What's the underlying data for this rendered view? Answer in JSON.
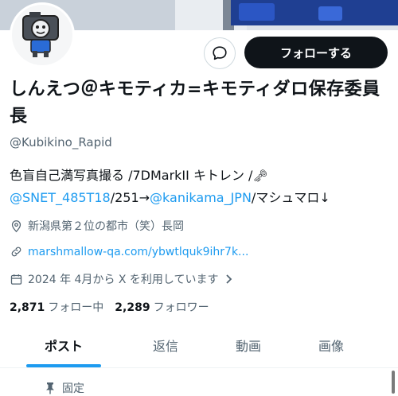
{
  "profile": {
    "display_name": "しんえつ＠キモティカ=キモティダロ保存委員長",
    "handle": "@Kubikino_Rapid"
  },
  "actions": {
    "message_icon": "chat-bubble-icon",
    "follow_label": "フォローする"
  },
  "bio": {
    "line1_text": "色盲自己満写真撮る /7DMarkII キトレン /",
    "key_icon": "key-emoji-icon",
    "mention1": "@SNET_485T18",
    "mid_text": "/251→",
    "mention2": "@kanikama_JPN",
    "end_text": "/マシュマロ↓"
  },
  "meta": {
    "location": "新潟県第２位の都市（笑）長岡",
    "website": "marshmallow-qa.com/ybwtlquk9ihr7k...",
    "joined": "2024 年 4月から X を利用しています"
  },
  "stats": {
    "following_count": "2,871",
    "following_label": "フォロー中",
    "followers_count": "2,289",
    "followers_label": "フォロワー"
  },
  "tabs": [
    {
      "label": "ポスト",
      "active": true
    },
    {
      "label": "返信",
      "active": false
    },
    {
      "label": "動画",
      "active": false
    },
    {
      "label": "画像",
      "active": false
    }
  ],
  "pinned_label": "固定",
  "colors": {
    "accent": "#1d9bf0",
    "text": "#0f1419",
    "muted": "#536471",
    "follow_bg": "#0f1419"
  }
}
